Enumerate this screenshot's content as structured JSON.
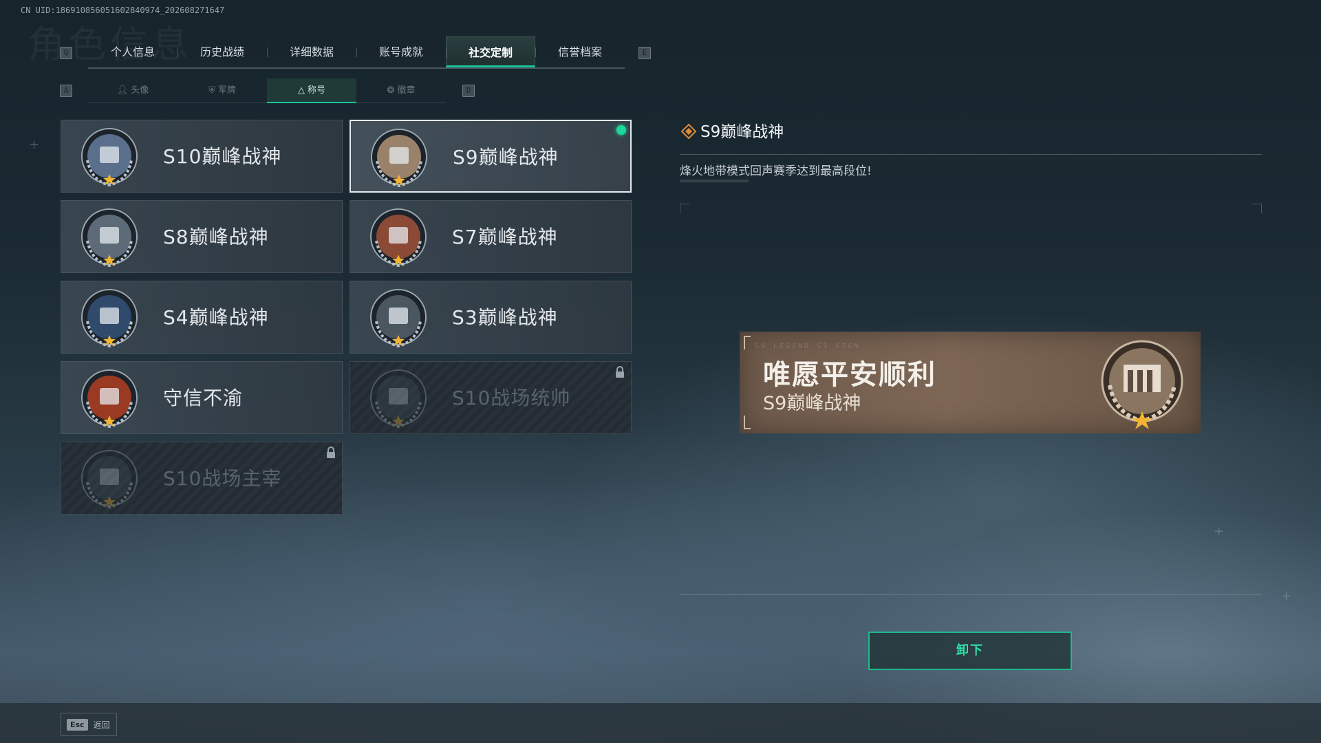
{
  "uid": "CN UID:186910856051602840974_202608271647",
  "bg_title": "角色信息",
  "keys": {
    "prev_tab": "Q",
    "next_tab": "E",
    "prev_sub": "A",
    "next_sub": "D"
  },
  "tabs": [
    {
      "label": "个人信息",
      "active": false
    },
    {
      "label": "历史战绩",
      "active": false
    },
    {
      "label": "详细数据",
      "active": false
    },
    {
      "label": "账号成就",
      "active": false
    },
    {
      "label": "社交定制",
      "active": true
    },
    {
      "label": "信誉档案",
      "active": false
    }
  ],
  "subtabs": [
    {
      "label": "头像",
      "icon": "person-icon",
      "active": false
    },
    {
      "label": "军牌",
      "icon": "shield-icon",
      "active": false
    },
    {
      "label": "称号",
      "icon": "triangle-icon",
      "active": true
    },
    {
      "label": "徽章",
      "icon": "badge-icon",
      "active": false
    }
  ],
  "titles": [
    {
      "name": "S10巅峰战神",
      "color": "#5a6f8c",
      "locked": false,
      "selected": false
    },
    {
      "name": "S9巅峰战神",
      "color": "#9a826a",
      "locked": false,
      "selected": true
    },
    {
      "name": "S8巅峰战神",
      "color": "#5d6b78",
      "locked": false,
      "selected": false
    },
    {
      "name": "S7巅峰战神",
      "color": "#8a4a36",
      "locked": false,
      "selected": false
    },
    {
      "name": "S4巅峰战神",
      "color": "#2f4a6a",
      "locked": false,
      "selected": false
    },
    {
      "name": "S3巅峰战神",
      "color": "#4a5660",
      "locked": false,
      "selected": false
    },
    {
      "name": "守信不渝",
      "color": "#9a3a22",
      "locked": false,
      "selected": false
    },
    {
      "name": "S10战场统帅",
      "color": "#3c4853",
      "locked": true,
      "selected": false
    },
    {
      "name": "S10战场主宰",
      "color": "#3c4853",
      "locked": true,
      "selected": false
    }
  ],
  "detail": {
    "title": "S9巅峰战神",
    "description": "烽火地带模式回声赛季达到最高段位!",
    "accent": "#e08a3a"
  },
  "banner": {
    "slogan": "唯愿平安顺利",
    "title": "S9巅峰战神",
    "code": "S9_LEGEND  S1 SIGN"
  },
  "unequip_label": "卸下",
  "footer": {
    "key": "Esc",
    "label": "返回"
  },
  "colors": {
    "accent_green": "#19c59b",
    "equipped_dot": "#1bd89a"
  }
}
